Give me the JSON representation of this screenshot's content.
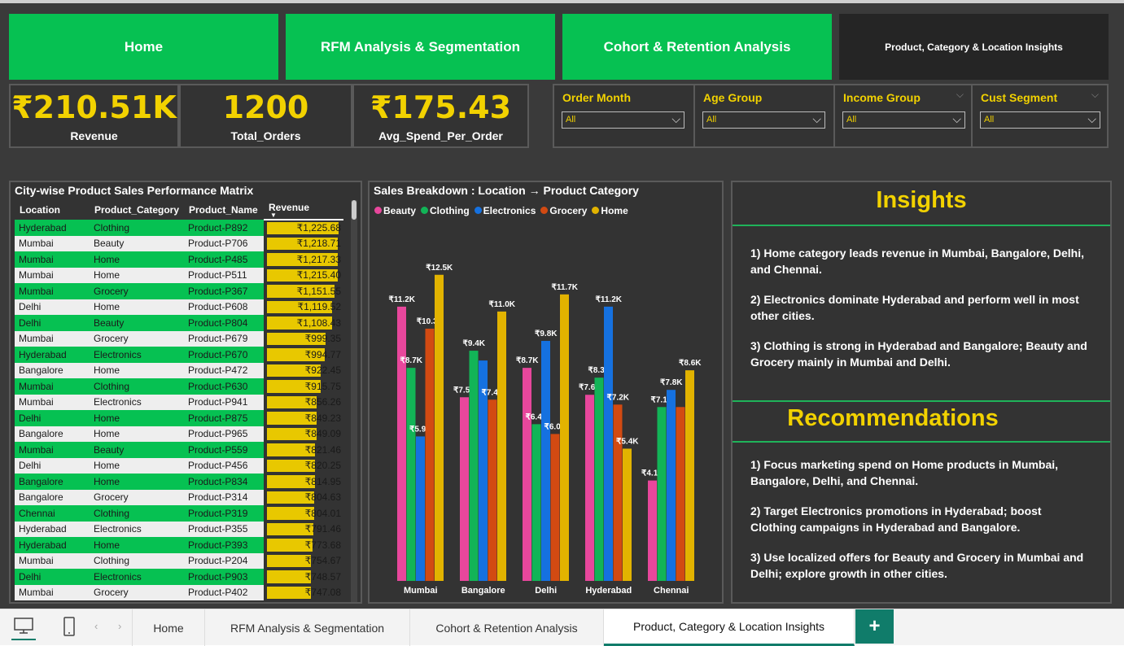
{
  "nav": {
    "home": "Home",
    "rfm": "RFM Analysis & Segmentation",
    "cohort": "Cohort & Retention Analysis",
    "product": "Product, Category & Location Insights"
  },
  "kpis": [
    {
      "value": "₹210.51K",
      "label": "Revenue"
    },
    {
      "value": "1200",
      "label": "Total_Orders"
    },
    {
      "value": "₹175.43",
      "label": "Avg_Spend_Per_Order"
    }
  ],
  "slicers": [
    {
      "title": "Order Month",
      "value": "All"
    },
    {
      "title": "Age Group",
      "value": "All"
    },
    {
      "title": "Income Group",
      "value": "All"
    },
    {
      "title": "Cust Segment",
      "value": "All"
    }
  ],
  "matrix": {
    "title": "City-wise Product Sales Performance Matrix",
    "columns": [
      "Location",
      "Product_Category",
      "Product_Name",
      "Revenue"
    ],
    "max_revenue": 1225.68,
    "rows": [
      [
        "Hyderabad",
        "Clothing",
        "Product-P892",
        "₹1,225.68",
        1225.68
      ],
      [
        "Mumbai",
        "Beauty",
        "Product-P706",
        "₹1,218.71",
        1218.71
      ],
      [
        "Mumbai",
        "Home",
        "Product-P485",
        "₹1,217.33",
        1217.33
      ],
      [
        "Mumbai",
        "Home",
        "Product-P511",
        "₹1,215.40",
        1215.4
      ],
      [
        "Mumbai",
        "Grocery",
        "Product-P367",
        "₹1,151.55",
        1151.55
      ],
      [
        "Delhi",
        "Home",
        "Product-P608",
        "₹1,119.52",
        1119.52
      ],
      [
        "Delhi",
        "Beauty",
        "Product-P804",
        "₹1,108.43",
        1108.43
      ],
      [
        "Mumbai",
        "Grocery",
        "Product-P679",
        "₹999.35",
        999.35
      ],
      [
        "Hyderabad",
        "Electronics",
        "Product-P670",
        "₹994.77",
        994.77
      ],
      [
        "Bangalore",
        "Home",
        "Product-P472",
        "₹922.45",
        922.45
      ],
      [
        "Mumbai",
        "Clothing",
        "Product-P630",
        "₹915.75",
        915.75
      ],
      [
        "Mumbai",
        "Electronics",
        "Product-P941",
        "₹856.26",
        856.26
      ],
      [
        "Delhi",
        "Home",
        "Product-P875",
        "₹849.23",
        849.23
      ],
      [
        "Bangalore",
        "Home",
        "Product-P965",
        "₹849.09",
        849.09
      ],
      [
        "Mumbai",
        "Beauty",
        "Product-P559",
        "₹821.46",
        821.46
      ],
      [
        "Delhi",
        "Home",
        "Product-P456",
        "₹820.25",
        820.25
      ],
      [
        "Bangalore",
        "Home",
        "Product-P834",
        "₹814.95",
        814.95
      ],
      [
        "Bangalore",
        "Grocery",
        "Product-P314",
        "₹804.63",
        804.63
      ],
      [
        "Chennai",
        "Clothing",
        "Product-P319",
        "₹804.01",
        804.01
      ],
      [
        "Hyderabad",
        "Electronics",
        "Product-P355",
        "₹791.46",
        791.46
      ],
      [
        "Hyderabad",
        "Home",
        "Product-P393",
        "₹773.68",
        773.68
      ],
      [
        "Mumbai",
        "Clothing",
        "Product-P204",
        "₹754.67",
        754.67
      ],
      [
        "Delhi",
        "Electronics",
        "Product-P903",
        "₹748.57",
        748.57
      ],
      [
        "Mumbai",
        "Grocery",
        "Product-P402",
        "₹747.08",
        747.08
      ]
    ]
  },
  "chart_data": {
    "type": "bar",
    "title": "Sales Breakdown : Location → Product Category",
    "categories": [
      "Mumbai",
      "Bangalore",
      "Delhi",
      "Hyderabad",
      "Chennai"
    ],
    "series": [
      {
        "name": "Beauty",
        "color": "#e8479c",
        "values": [
          11.2,
          7.5,
          8.7,
          7.6,
          4.1
        ],
        "labels": [
          "₹11.2K",
          "₹7.5K",
          "₹8.7K",
          "₹7.6K",
          "₹4.1K"
        ]
      },
      {
        "name": "Clothing",
        "color": "#12b457",
        "values": [
          8.7,
          9.4,
          6.4,
          8.3,
          7.1
        ],
        "labels": [
          "₹8.7K",
          "₹9.4K",
          "₹6.4K",
          "₹8.3K",
          "₹7.1K"
        ]
      },
      {
        "name": "Electronics",
        "color": "#1571e0",
        "values": [
          5.9,
          9.0,
          9.8,
          11.2,
          7.8
        ],
        "labels": [
          "₹5.9K",
          "",
          "₹9.8K",
          "₹11.2K",
          "₹7.8K"
        ]
      },
      {
        "name": "Grocery",
        "color": "#d24a12",
        "values": [
          10.3,
          7.4,
          6.0,
          7.2,
          7.1
        ],
        "labels": [
          "₹10.3K",
          "₹7.4K",
          "₹6.0K",
          "₹7.2K",
          ""
        ]
      },
      {
        "name": "Home",
        "color": "#e2b300",
        "values": [
          12.5,
          11.0,
          11.7,
          5.4,
          8.6
        ],
        "labels": [
          "₹12.5K",
          "₹11.0K",
          "₹11.7K",
          "₹5.4K",
          "₹8.6K"
        ]
      }
    ],
    "ylim": [
      0,
      13
    ],
    "legend": "top-left"
  },
  "insights": {
    "title": "Insights",
    "items": [
      "1) Home category leads revenue in Mumbai, Bangalore, Delhi, and Chennai.",
      "2) Electronics dominate Hyderabad and perform well in most other cities.",
      "3) Clothing is strong in Hyderabad and Bangalore; Beauty and Grocery mainly in Mumbai and Delhi."
    ]
  },
  "recommendations": {
    "title": "Recommendations",
    "items": [
      "1) Focus marketing spend on Home products in Mumbai, Bangalore, Delhi, and Chennai.",
      "2) Target Electronics promotions in Hyderabad; boost Clothing campaigns in Hyderabad and Bangalore.",
      "3) Use localized offers for Beauty and Grocery in Mumbai and Delhi; explore growth in other cities."
    ]
  },
  "tabs": {
    "items": [
      "Home",
      "RFM Analysis & Segmentation",
      "Cohort & Retention Analysis",
      "Product, Category & Location Insights"
    ],
    "add": "+"
  },
  "colors": {
    "accent_green": "#06c152",
    "kpi_yellow": "#f2d200",
    "background": "#3a3a3a"
  }
}
